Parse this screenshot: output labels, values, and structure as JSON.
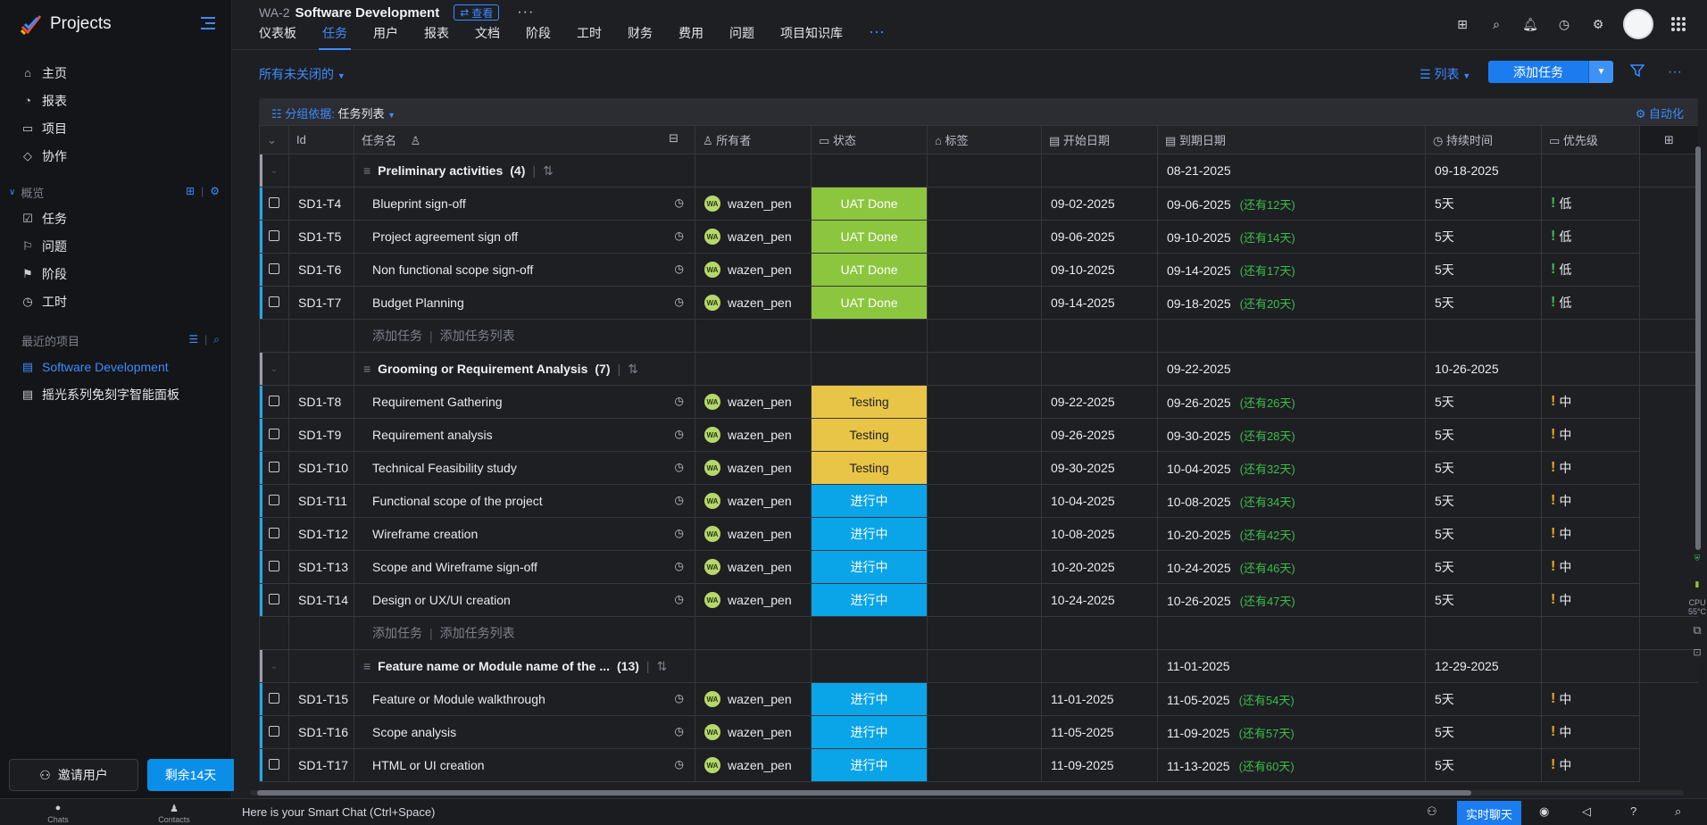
{
  "app": {
    "name": "Projects"
  },
  "sidebar": {
    "main_items": [
      {
        "label": "主页",
        "icon": "home-icon"
      },
      {
        "label": "报表",
        "icon": "report-icon"
      },
      {
        "label": "项目",
        "icon": "folder-icon"
      },
      {
        "label": "协作",
        "icon": "collaborate-icon"
      }
    ],
    "overview_label": "概览",
    "overview_items": [
      {
        "label": "任务",
        "icon": "task-icon"
      },
      {
        "label": "问题",
        "icon": "issue-icon"
      },
      {
        "label": "阶段",
        "icon": "phase-icon"
      },
      {
        "label": "工时",
        "icon": "timesheet-icon"
      }
    ],
    "recent_label": "最近的项目",
    "recent_items": [
      {
        "label": "Software Development"
      },
      {
        "label": "摇光系列免刻字智能面板"
      }
    ],
    "invite_label": "邀请用户",
    "trial_label": "剩余14天"
  },
  "header": {
    "project_id": "WA-2",
    "project_name": "Software Development",
    "view_badge": "查看",
    "tabs": [
      "仪表板",
      "任务",
      "用户",
      "报表",
      "文档",
      "阶段",
      "工时",
      "财务",
      "费用",
      "问题",
      "项目知识库"
    ],
    "active_tab": "任务"
  },
  "toolbar": {
    "filter": "所有未关闭的",
    "view": "列表",
    "add_task": "添加任务",
    "group_by_label": "分组依据:",
    "group_by_value": "任务列表",
    "automation": "自动化"
  },
  "columns": {
    "id": "Id",
    "task_name": "任务名",
    "owner": "所有者",
    "status": "状态",
    "tags": "标签",
    "start": "开始日期",
    "due": "到期日期",
    "duration": "持续时间",
    "priority": "优先级"
  },
  "groups": [
    {
      "title": "Preliminary activities",
      "count": "(4)",
      "start": "08-21-2025",
      "due": "09-18-2025",
      "tasks": [
        {
          "id": "SD1-T4",
          "name": "Blueprint sign-off",
          "owner": "wazen_pen",
          "status": "UAT Done",
          "start": "09-02-2025",
          "due": "09-06-2025",
          "remain": "(还有12天)",
          "duration": "5天",
          "priority": "低"
        },
        {
          "id": "SD1-T5",
          "name": "Project agreement sign off",
          "owner": "wazen_pen",
          "status": "UAT Done",
          "start": "09-06-2025",
          "due": "09-10-2025",
          "remain": "(还有14天)",
          "duration": "5天",
          "priority": "低"
        },
        {
          "id": "SD1-T6",
          "name": "Non functional scope sign-off",
          "owner": "wazen_pen",
          "status": "UAT Done",
          "start": "09-10-2025",
          "due": "09-14-2025",
          "remain": "(还有17天)",
          "duration": "5天",
          "priority": "低"
        },
        {
          "id": "SD1-T7",
          "name": "Budget Planning",
          "owner": "wazen_pen",
          "status": "UAT Done",
          "start": "09-14-2025",
          "due": "09-18-2025",
          "remain": "(还有20天)",
          "duration": "5天",
          "priority": "低"
        }
      ]
    },
    {
      "title": "Grooming or Requirement Analysis",
      "count": "(7)",
      "start": "09-22-2025",
      "due": "10-26-2025",
      "tasks": [
        {
          "id": "SD1-T8",
          "name": "Requirement Gathering",
          "owner": "wazen_pen",
          "status": "Testing",
          "start": "09-22-2025",
          "due": "09-26-2025",
          "remain": "(还有26天)",
          "duration": "5天",
          "priority": "中"
        },
        {
          "id": "SD1-T9",
          "name": "Requirement analysis",
          "owner": "wazen_pen",
          "status": "Testing",
          "start": "09-26-2025",
          "due": "09-30-2025",
          "remain": "(还有28天)",
          "duration": "5天",
          "priority": "中"
        },
        {
          "id": "SD1-T10",
          "name": "Technical Feasibility study",
          "owner": "wazen_pen",
          "status": "Testing",
          "start": "09-30-2025",
          "due": "10-04-2025",
          "remain": "(还有32天)",
          "duration": "5天",
          "priority": "中"
        },
        {
          "id": "SD1-T11",
          "name": "Functional scope of the project",
          "owner": "wazen_pen",
          "status": "进行中",
          "start": "10-04-2025",
          "due": "10-08-2025",
          "remain": "(还有34天)",
          "duration": "5天",
          "priority": "中"
        },
        {
          "id": "SD1-T12",
          "name": "Wireframe creation",
          "owner": "wazen_pen",
          "status": "进行中",
          "start": "10-08-2025",
          "due": "10-20-2025",
          "remain": "(还有42天)",
          "duration": "5天",
          "priority": "中"
        },
        {
          "id": "SD1-T13",
          "name": "Scope and Wireframe sign-off",
          "owner": "wazen_pen",
          "status": "进行中",
          "start": "10-20-2025",
          "due": "10-24-2025",
          "remain": "(还有46天)",
          "duration": "5天",
          "priority": "中"
        },
        {
          "id": "SD1-T14",
          "name": "Design or UX/UI creation",
          "owner": "wazen_pen",
          "status": "进行中",
          "start": "10-24-2025",
          "due": "10-26-2025",
          "remain": "(还有47天)",
          "duration": "5天",
          "priority": "中"
        }
      ]
    },
    {
      "title": "Feature name or Module name of the ...",
      "count": "(13)",
      "start": "11-01-2025",
      "due": "12-29-2025",
      "tasks": [
        {
          "id": "SD1-T15",
          "name": "Feature or Module walkthrough",
          "owner": "wazen_pen",
          "status": "进行中",
          "start": "11-01-2025",
          "due": "11-05-2025",
          "remain": "(还有54天)",
          "duration": "5天",
          "priority": "中"
        },
        {
          "id": "SD1-T16",
          "name": "Scope analysis",
          "owner": "wazen_pen",
          "status": "进行中",
          "start": "11-05-2025",
          "due": "11-09-2025",
          "remain": "(还有57天)",
          "duration": "5天",
          "priority": "中"
        },
        {
          "id": "SD1-T17",
          "name": "HTML or UI creation",
          "owner": "wazen_pen",
          "status": "进行中",
          "start": "11-09-2025",
          "due": "11-13-2025",
          "remain": "(还有60天)",
          "duration": "5天",
          "priority": "中"
        }
      ]
    }
  ],
  "add_row": {
    "add_task": "添加任务",
    "add_list": "添加任务列表"
  },
  "owner_initials": "WA",
  "status_colors": {
    "UAT Done": "#8cc63f",
    "Testing": "#e8c547",
    "进行中": "#0aa4e8"
  },
  "bottombar": {
    "chats": "Chats",
    "contacts": "Contacts",
    "smart_chat": "Here is your Smart Chat (Ctrl+Space)",
    "live_chat": "实时聊天"
  },
  "side_widget": {
    "cpu_label": "CPU",
    "cpu_temp": "55°C"
  }
}
